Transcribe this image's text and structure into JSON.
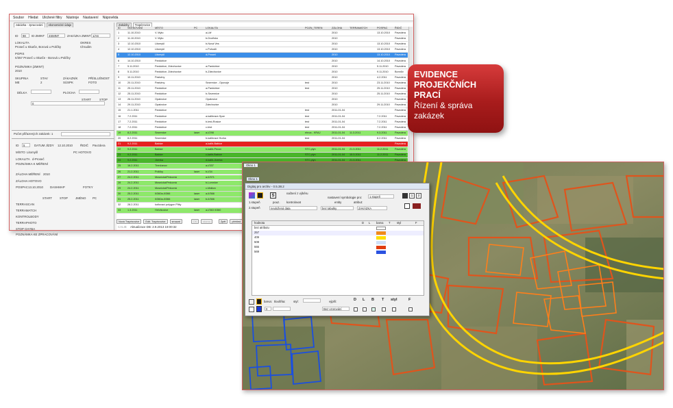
{
  "menu": [
    "Soubor",
    "Hledat",
    "Uložené filtry",
    "Nástroje",
    "Nastavení",
    "Nápověda"
  ],
  "left_tabs": [
    "zakázka - zpracování",
    "ekonomické údaje"
  ],
  "right_tabs": [
    "Zakázky",
    "Trapézovice"
  ],
  "detail": {
    "id_label": "ID",
    "id_val": "98",
    "zmint_id_label": "ID ZMINT",
    "zmint_id_val": "4SMINT",
    "zak_zmint_label": "ZAKÁZKA ZMINT",
    "zak_zmint_val": "1/AS",
    "lokalita_label": "LOKALITA",
    "lokalita_val": "Proseč u Skutče, Borová u Poličky",
    "okres_label": "OKRES",
    "okres_val": "Chrudim",
    "popis_label": "POPIS",
    "popis_val": "II/357 Proseč u Skutče - Borová u Poličky",
    "pozn_label": "POZNÁMKA (ZMINT)",
    "pozn_val": "2010",
    "skupina_label": "SKUPINA",
    "skupina_val": "ME",
    "stav_label": "STAV",
    "stav_val": "2",
    "zakaznik_label": "ZÁKAZNÍK",
    "zakaznik_val": "SÚSPK",
    "prisl_label": "PŘÍSLUŠNOST",
    "prisl_val": "FOTO",
    "delka_label": "DÉLKA",
    "plocha_label": "PLOCHA",
    "start_label": "START",
    "stop_label": "STOP",
    "zero_val": "0",
    "count_label": "Počet přiřazených zakázek: 1"
  },
  "detail2": {
    "id_label": "ID",
    "id_val": "5",
    "datum_label": "DATUM JÍZDY",
    "datum_val": "12.10.2010",
    "ridic_label": "ŘIDIČ",
    "ridic_val": "Pavzdera",
    "misto_label": "MÍSTO",
    "misto_val": "Litomyšl",
    "pc_label": "PC HOTOVO",
    "lokalita_label": "LOKALITA",
    "lokalita_val": "d-Proseč",
    "pozn_label": "POZNÁMKA K MĚŘENÍ",
    "zaloha_label": "ZÁLOHA MĚŘENÍ",
    "zaloha_val": "2010",
    "zaloha_h_label": "ZÁLOHA HOTOVO",
    "pospac_label": "POSPAC",
    "pospac_val": "13.10.2010",
    "dashmap_label": "DASHMAP",
    "fotky_label": "FOTKY",
    "start_label": "START",
    "stop_label": "STOP",
    "jmeno_label": "JMÉNO",
    "pc2_label": "PC",
    "rows": [
      "TERRASCAN",
      "TERRAMATCH",
      "KONTROLBODY",
      "TERRAPHOTO",
      "STOP CHYBA",
      "POZNÁMKA KE ZPRACOVÁNÍ"
    ]
  },
  "grid_headers": [
    "ID",
    "SKENOVÁNÍ",
    "MÍSTO",
    "PC",
    "LOKALITA",
    "POZN_TEREN",
    "ZÁLOHA",
    "TERRAMATCH",
    "POSPAC",
    "ŘIDIČ"
  ],
  "grid_rows": [
    [
      "1",
      "11.10.2010",
      "V. Mýto",
      "",
      "a-Litř",
      "",
      "2010",
      "",
      "13.10.2010",
      "Pavzdera",
      "w"
    ],
    [
      "2",
      "11.10.2010",
      "V. Mýto",
      "",
      "b-Dvořisko",
      "",
      "2010",
      "",
      "",
      "Pavzdera",
      "w"
    ],
    [
      "3",
      "12.10.2010",
      "Litomyšl",
      "",
      "b-Nová Ves",
      "",
      "2010",
      "",
      "13.10.2010",
      "Pavzdera",
      "w"
    ],
    [
      "4",
      "12.10.2010",
      "Litomyšl",
      "",
      "c-Pohodlí",
      "",
      "2010",
      "",
      "13.10.2010",
      "Pavzdera",
      "w"
    ],
    [
      "5",
      "12.10.2010",
      "Litomyšl",
      "",
      "d-Proseč",
      "",
      "2010",
      "",
      "13.10.2010",
      "Pavzdera",
      "sel"
    ],
    [
      "6",
      "14.10.2010",
      "Pardubice",
      "",
      "",
      "",
      "2010",
      "",
      "14.10.2010",
      "Pavzdera",
      "w"
    ],
    [
      "7",
      "5.11.2010",
      "Pardubice, Zdechovice",
      "",
      "a-Pardubice",
      "",
      "2010",
      "",
      "5.11.2010",
      "Pavzdera",
      "w"
    ],
    [
      "8",
      "5.11.2010",
      "Pardubice, Zdechovice",
      "",
      "b-Zdechovice",
      "",
      "2010",
      "",
      "9.11.2010",
      "Bonnův",
      "w"
    ],
    [
      "9",
      "10.11.2010",
      "Pastviny",
      "",
      "",
      "",
      "2010",
      "",
      "4.2.2011",
      "Pavzdera",
      "w"
    ],
    [
      "10",
      "20.11.2010",
      "Pastviny",
      "",
      "Sezemice - Opovoje",
      "test",
      "2010",
      "",
      "23.11.2010",
      "Pavzdera",
      "w"
    ],
    [
      "11",
      "25.11.2010",
      "Pardubice",
      "",
      "a-Pardubice",
      "test",
      "2010",
      "",
      "25.11.2010",
      "Pavzdera",
      "w"
    ],
    [
      "12",
      "25.11.2010",
      "Pardubice",
      "",
      "b-Sezemice",
      "",
      "2010",
      "",
      "25.11.2010",
      "Pavzdera",
      "w"
    ],
    [
      "13",
      "26.11.2010",
      "Opatovice",
      "",
      "Opatovice",
      "",
      "2010",
      "",
      "",
      "Pavzdera",
      "w"
    ],
    [
      "14",
      "29.11.2010",
      "Opatovice",
      "",
      "Zdechovice",
      "",
      "2010",
      "",
      "29.11.2010",
      "Pavzdera",
      "w"
    ],
    [
      "15",
      "21.1.2011",
      "Pardubice",
      "",
      "",
      "test",
      "2011-01-04",
      "",
      "",
      "Pavzdera",
      "w"
    ],
    [
      "16",
      "7.2.2011",
      "Pardubice",
      "",
      "a-kalibrace-Spar",
      "test",
      "2011-01-04",
      "",
      "7.2.2011",
      "Pavzdera",
      "w"
    ],
    [
      "17",
      "7.2.2011",
      "Pardubice",
      "",
      "b-test-Rosice",
      "test",
      "2011-01-04",
      "",
      "7.2.2011",
      "Pavzdera",
      "w"
    ],
    [
      "18",
      "7.2.2011",
      "Pardubice",
      "",
      "c-test",
      "test",
      "2011-01-04",
      "",
      "7.2.2011",
      "Pavzdera",
      "w"
    ],
    [
      "19",
      "8.2.2011",
      "Sezemice",
      "laser",
      "a-I/298",
      "ehrca - KRAJ",
      "2011-01-04",
      "11.3.2011",
      "9.3.2011",
      "Pavzdera",
      "g"
    ],
    [
      "20",
      "8.2.2011",
      "Sezemice",
      "",
      "b-kalibrace Hurka",
      "test",
      "2011-01-04",
      "",
      "8.2.2011",
      "Pavzdera",
      "w"
    ],
    [
      "21",
      "9.2.2011",
      "Babice",
      "",
      "a-kalib-Babice",
      "",
      "",
      "",
      "",
      "Pavzdera",
      "r"
    ],
    [
      "22",
      "9.2.2011",
      "Babice",
      "",
      "b-kalib-Pecov",
      "STC.plyn",
      "2011-01-04",
      "21.3.2011",
      "11.2.2011",
      "Pavzdera",
      "g"
    ],
    [
      "23",
      "9.2.2011",
      "Babice",
      "",
      "c-kalib-Babice",
      "STC.plyn",
      "2011-01-04",
      "15.3.2011",
      "11.2.2011",
      "Pavzdera",
      "dg"
    ],
    [
      "24",
      "9.2.2011",
      "Jizerka",
      "",
      "d-kalib-Jizerka",
      "STC.plyn",
      "2011-01-04",
      "21.3.2011",
      "",
      "Pavzdera",
      "dg"
    ],
    [
      "25",
      "16.2.2011",
      "Trenčanov",
      "",
      "a-I/337",
      "",
      "",
      "",
      "",
      "",
      "g"
    ],
    [
      "26",
      "21.2.2011",
      "Poličky",
      "laser",
      "b-I/34",
      "",
      "",
      "",
      "",
      "",
      "g"
    ],
    [
      "27",
      "24.2.2011",
      "Mosnická/Pekovná",
      "",
      "a-II/371",
      "",
      "",
      "",
      "",
      "",
      "g"
    ],
    [
      "28",
      "24.2.2011",
      "Mosnická/Pekovná",
      "",
      "b-Lomnice",
      "",
      "",
      "",
      "",
      "",
      "g"
    ],
    [
      "29",
      "24.2.2011",
      "Mosnická/Pekovná",
      "",
      "c-Malkov",
      "",
      "",
      "",
      "",
      "",
      "g"
    ],
    [
      "30",
      "25.2.2011",
      "II/360a-II/366",
      "laser",
      "a-II/366",
      "",
      "",
      "",
      "",
      "",
      "g"
    ],
    [
      "31",
      "25.2.2011",
      "II/360a-II/366",
      "laser",
      "b-II/366",
      "",
      "",
      "",
      "",
      "",
      "g"
    ],
    [
      "32",
      "28.2.2011",
      "kotlovací polygon Plišy",
      "",
      "",
      "",
      "",
      "",
      "",
      "",
      "w"
    ],
    [
      "33",
      "1.3.2011",
      "Helvíkovice",
      "laser",
      "a-I/363 II/360",
      "",
      "",
      "",
      "",
      "",
      "g"
    ]
  ],
  "buttons": [
    "Nová Trapézovice",
    "Edit. Trapézovice",
    "smazat",
    "OK",
    "storno",
    "Zpět",
    "přehled"
  ],
  "status_text": "Aktualizace DB: 2.9.2013 19:00:32",
  "status_prefix": "CALIB",
  "badge": {
    "title1": "EVIDENCE",
    "title2": "PROJEKČNÍCH",
    "title3": "PRACÍ",
    "sub1": "Řízení & správa",
    "sub2": "zakázek"
  },
  "colors": {
    "accent_red": "#b01e1e",
    "row_green": "#8ee86b",
    "row_darkgreen": "#49b52a",
    "row_red": "#e52020",
    "row_sel": "#3b8ee8"
  },
  "dialog": {
    "title": "Okno 1",
    "subtitle": "Digitaj pro archiv - 0.5.38.2",
    "nacteni_label": "načtení z výběru",
    "nastaveni_label": "nastavení symbologie pro:",
    "stupen_val": "1.stupeň",
    "stupen1_label": "1.stupeň",
    "stupen2_label": "2.stupeň",
    "pouz_label": "pouz.",
    "kontrolovat_label": "kontrolovat",
    "entity_label": "entity",
    "atribut_label": "atribut:",
    "neulozena_val": "neuložená data",
    "tabulka_val": "bez tabulky",
    "zakazka_val": "ZAKÁZKA",
    "table_headers": [
      "hodnota",
      "D",
      "L",
      "barva",
      "T",
      "styl",
      "F"
    ],
    "table_rows": [
      "bez atributu",
      "257",
      "409",
      "508",
      "555",
      "569"
    ],
    "bottom_barva": "barva:",
    "bottom_tloustka": "tloušťka:",
    "bottom_styl": "styl:",
    "bottom_vypln": "výplň:",
    "bottom_letters": [
      "D",
      "L",
      "B",
      "T",
      "styl",
      "F"
    ],
    "bottom_bez": "Bez vzorování",
    "pct_label": "0",
    "right_nums": [
      "1",
      "2"
    ]
  }
}
